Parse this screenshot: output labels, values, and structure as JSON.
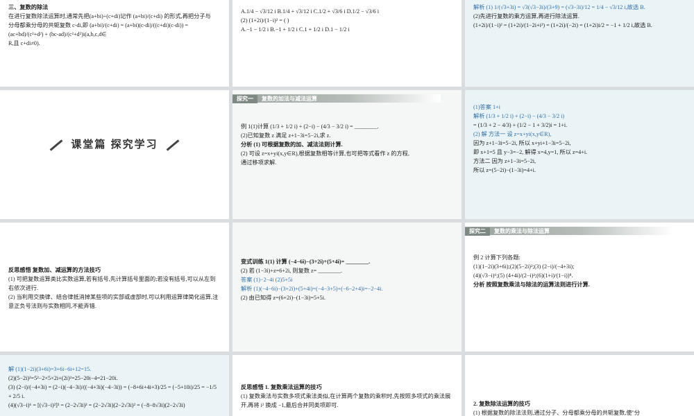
{
  "t_r0c0": [
    {
      "cls": "hd",
      "text": "三、复数的除法"
    },
    {
      "cls": "",
      "text": "在进行复数除法运算时,通常先把(a+bi)÷(c+di)记作 (a+bi)/(c+di) 的形式,再把分子与"
    },
    {
      "cls": "",
      "text": "分母都乘分母的共轭复数 c-di,即 (a+bi)/(c+di) = (a+bi)(c-di)/((c+di)(c-di)) = (ac+bd)/(c²+d²) + (bc-ad)/(c²+d²)i(a,b,c,d∈"
    },
    {
      "cls": "",
      "text": "R,且 c+di≠0)."
    }
  ],
  "t_r0c1": [
    {
      "cls": "",
      "text": "A.1/4 − √3/12 i    B.1/4 + √3/12 i    C.1/2 + √3/6 i    D.1/2 − √3/6 i"
    },
    {
      "cls": "",
      "text": "(2) (1+2i)/(1−i)² = (        )"
    },
    {
      "cls": "",
      "text": "A.−1 − 1/2 i                B.−1 + 1/2 i                C.1 + 1/2 i                D.1 − 1/2 i"
    }
  ],
  "t_r0c2": [
    {
      "cls": "ans",
      "text": "解析  (1) 1/(√3+3i) = √3(√3−3i)/(3+9) = (√3−3i)/12 = 1/4 − √3/12 i,故选 B."
    },
    {
      "cls": "",
      "text": "(2)先进行复数的乘方运算,再进行除法运算."
    },
    {
      "cls": "",
      "text": "(1+2i)/(1−i)² = (1+2i)/(1−2i+i²) = (1+2i)/(−2i) = (1+2i)i/2 = −1 + 1/2 i,故选 B."
    }
  ],
  "center_title": "课堂篇  探究学习",
  "band1": {
    "tag": "探究一",
    "title": "复数的加法与减法运算"
  },
  "t_r1c1": [
    {
      "cls": "",
      "text": "例 1(1)计算 (1/3 + 1/2 i) + (2−i) − (4/3 − 3/2 i) = ________."
    },
    {
      "cls": "",
      "text": "(2)已知复数 z 满足 z+1−3i=5−2i,求 z."
    },
    {
      "cls": "hd",
      "text": "分析 (1) 可根据复数的加、减法法则计算."
    },
    {
      "cls": "",
      "text": "(2) 可设 z=x+yi(x,y∈R),根据复数相等计算,也可把等式看作 z 的方程,"
    },
    {
      "cls": "",
      "text": "通过移项求解."
    }
  ],
  "t_r1c2": [
    {
      "cls": "ans",
      "text": "(1)答案  1+i"
    },
    {
      "cls": "ans",
      "text": "解析  (1/3 + 1/2 i) + (2−i) − (4/3 − 3/2 i)"
    },
    {
      "cls": "",
      "text": "= (1/3 + 2 − 4/3) + (1/2 − 1 + 3/2)i = 1+i."
    },
    {
      "cls": "ans",
      "text": "(2) 解  方法一    设 z=x+yi(x,y∈R),"
    },
    {
      "cls": "",
      "text": "因为 z+1−3i=5−2i, 所以 x+yi+1−3i=5−2i,"
    },
    {
      "cls": "",
      "text": "即 x+1=5 且 y−3=−2, 解得 x=4,y=1, 所以 z=4+i."
    },
    {
      "cls": "",
      "text": "方法二    因为 z+1−3i=5−2i,"
    },
    {
      "cls": "",
      "text": "所以 z=(5−2i)−(1−3i)=4+i."
    }
  ],
  "t_r2c0": [
    {
      "cls": "hd",
      "text": "反思感悟    复数加、减运算的方法技巧"
    },
    {
      "cls": "",
      "text": "(1) 可把复数运算类比实数运算,若有括号,先计算括号里面的;若没有括号,可以从左到右依次进行."
    },
    {
      "cls": "",
      "text": "(2) 当利用交换律、结合律抵消掉某些项的实部或虚部时,可以利用运算律简化运算,注意正负号法则与实数相同,不能弄错."
    }
  ],
  "t_r2c1": [
    {
      "cls": "hd",
      "text": "变式训练 1(1) 计算 (−4−6i)−(3+2i)+(5+4i)= ________."
    },
    {
      "cls": "",
      "text": "(2) 若 (1−3i)+z=6+2i, 则复数 z= ________."
    },
    {
      "cls": "ans",
      "text": "答案  (1)−2−4i      (2)5+5i"
    },
    {
      "cls": "ans",
      "text": "解析  (1)(−4−6i)−(3+2i)+(5+4i)=(−4−3+5)+(−6−2+4)i=−2−4i."
    },
    {
      "cls": "",
      "text": "(2) 由已知得 z=(6+2i)−(1−3i)=5+5i."
    }
  ],
  "band2": {
    "tag": "探究二",
    "title": "复数的乘法与除法运算"
  },
  "t_r2c2": [
    {
      "cls": "",
      "text": "例 2 计算下列各题:"
    },
    {
      "cls": "",
      "text": "(1)(1−2i)(3+6i);(2)(5−2i)²;(3) (2−i)/(−4+3i);"
    },
    {
      "cls": "",
      "text": "(4)(√3−i)⁶;(5) (4+4i)/(2−i)²;(6)(1+i)/(1−i))⁸."
    },
    {
      "cls": "hd",
      "text": "分析 按照复数乘法与除法的运算法则进行计算."
    }
  ],
  "t_r3c0": [
    {
      "cls": "ans",
      "text": "解  (1)(1−2i)(3+6i)=3+6i−6i+12=15."
    },
    {
      "cls": "",
      "text": "(2)(5−2i)²=5²−2×5×2i+(2i)²=25−20i−4=21−20i."
    },
    {
      "cls": "",
      "text": "(3) (2−i)/(−4+3i) = (2−i)(−4−3i)/((−4+3i)(−4−3i)) = (−8+6i+4i+3)/25 = (−5+10i)/25 = −1/5 + 2/5 i."
    },
    {
      "cls": "",
      "text": "(4)(√3−i)⁶ = [(√3−i)²]³ = (2−2√3i)³ = (2−2√3i)(2−2√3i)² = (−8−8√3i)(2−2√3i)"
    }
  ],
  "t_r3c1": [
    {
      "cls": "hd",
      "text": "反思感悟    1. 复数乘法运算的技巧"
    },
    {
      "cls": "",
      "text": "(1) 复数乘法与实数多项式乘法类似,在计算两个复数的乘积时,先按照多项式的乘法展开,再将 i² 换成 −1,最后合并同类项即可."
    }
  ],
  "t_r3c2": [
    {
      "cls": "hd",
      "text": "2. 复数除法运算的技巧"
    },
    {
      "cls": "",
      "text": "(1) 根据复数的除法法则,通过分子、分母都乘分母的共轭复数,使\"分"
    }
  ]
}
